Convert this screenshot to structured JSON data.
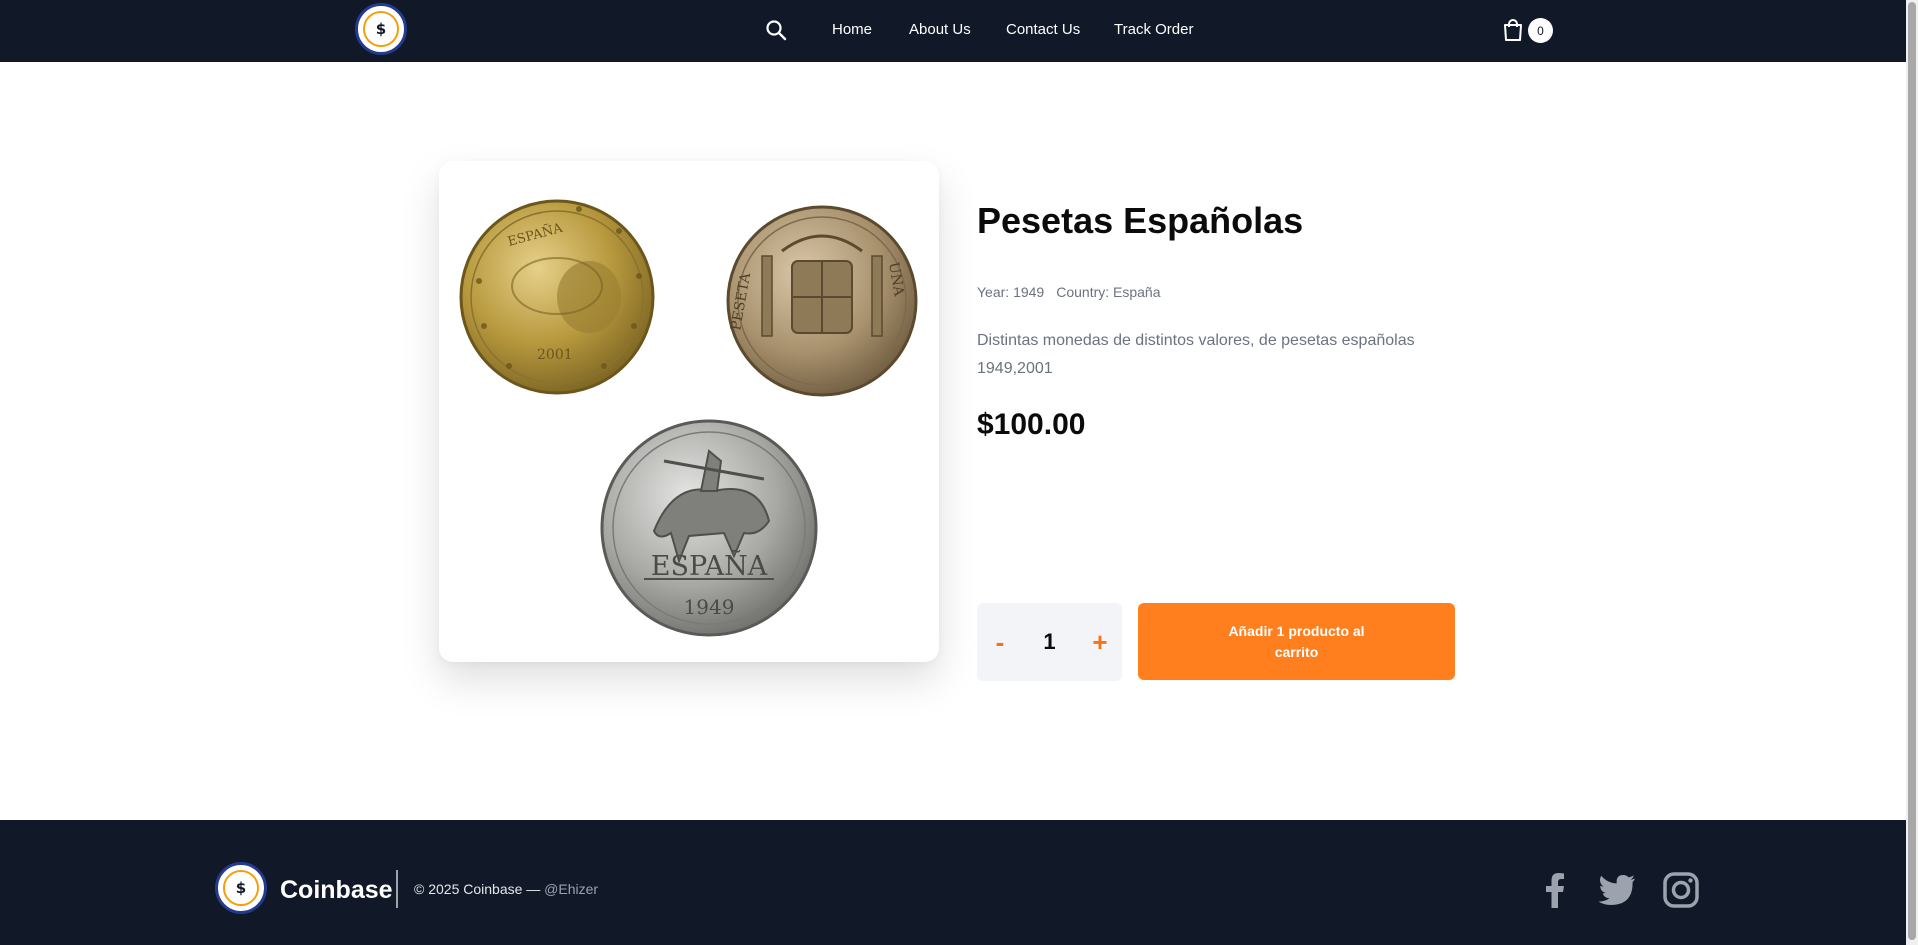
{
  "header": {
    "logo_symbol": "$",
    "nav": [
      {
        "label": "Home"
      },
      {
        "label": "About Us"
      },
      {
        "label": "Contact Us"
      },
      {
        "label": "Track Order"
      }
    ],
    "search_icon": "search-icon",
    "cart_icon": "shopping-bag-icon",
    "cart_count": "0"
  },
  "product": {
    "title": "Pesetas Españolas",
    "year_label": "Year: 1949",
    "country_label": "Country: España",
    "description": "Distintas monedas de distintos valores, de pesetas españolas 1949,2001",
    "price": "$100.00",
    "image_alt": "Three Spanish coins",
    "coin_inscriptions": [
      "ESPAÑA",
      "2001",
      "1949",
      "PESETA",
      "UNA"
    ]
  },
  "quantity": {
    "minus_label": "-",
    "value": "1",
    "plus_label": "+"
  },
  "add_to_cart_label": "Añadir 1 producto al carrito",
  "footer": {
    "logo_symbol": "$",
    "brand": "Coinbase",
    "copyright": "© 2025 Coinbase — ",
    "handle": "@Ehizer",
    "social": [
      "facebook-icon",
      "twitter-icon",
      "instagram-icon"
    ]
  },
  "colors": {
    "header_bg": "#111827",
    "accent": "#ff7f1e",
    "text_muted": "#6b7280"
  }
}
